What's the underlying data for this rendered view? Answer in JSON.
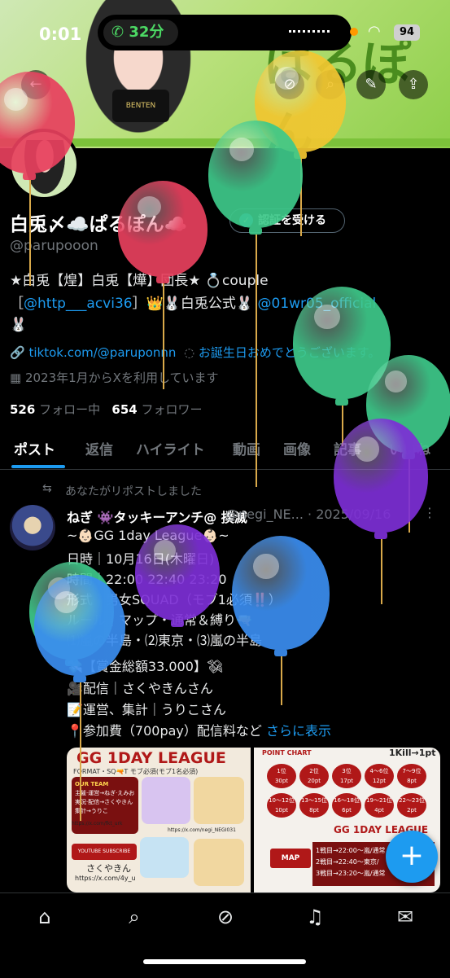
{
  "status_bar": {
    "time": "0:01",
    "call_duration": "32分",
    "battery": "94"
  },
  "banner": {
    "logo_text": "ぱるぽん",
    "shirt_text": "BENTEN"
  },
  "profile": {
    "display_name": "白兎〆☁️ぱるぽん☁️",
    "verify_button": "認証を受ける",
    "handle": "@parupooon",
    "bio_line1": "★白兎【煌】白兎【燁】団長★ 💍couple",
    "bio_line2_prefix": "［",
    "bio_mention1": "@http___acvi36",
    "bio_line2_mid": "］👑🐰白兎公式🐰",
    "bio_mention2": "@01wr05_official",
    "bio_line3": "🐰",
    "website": "tiktok.com/@paruponnn",
    "birthday": "お誕生日おめでとうございます。",
    "joined": "2023年1月からXを利用しています",
    "following_count": "526",
    "following_label": "フォロー中",
    "followers_count": "654",
    "followers_label": "フォロワー"
  },
  "tabs": [
    {
      "label": "ポスト"
    },
    {
      "label": "返信"
    },
    {
      "label": "ハイライト"
    },
    {
      "label": "動画"
    },
    {
      "label": "画像"
    },
    {
      "label": "記事"
    },
    {
      "label": "いいね"
    }
  ],
  "post": {
    "repost_note": "あなたがリポストしました",
    "author_name": "ねぎ 👾タッキーアンチ@ 撲滅",
    "author_handle": "@negi_NE...",
    "date": "2025/09/16",
    "lines": [
      "~👶🏻GG 1day League👶🏻~",
      "日時｜10月16日(木曜日)",
      "時間｜22:00 22:40 23:20",
      "形式｜男女SQUAD（モブ1必須‼️）",
      "ルール｜マップ・通常＆縛り🔫",
      "⑴嵐の半島・⑵東京・⑶嵐の半島",
      "💸【賞金総額33.000】💸︎",
      "🎥配信｜さくやきんさん",
      "📝運営、集計｜うりこさん",
      "📍参加費（700pay）配信料など"
    ],
    "show_more": "さらに表示",
    "media_left_title": "GG 1DAY LEAGUE",
    "media_left_sub": "FORMAT・SQ🔫T モブ必須(モブ1名必須)",
    "media_left_team": "OUR TEAM",
    "media_left_team_lines": [
      "主催·運営→ねぎ·えみお",
      "実況·配信→さくやきん",
      "集計→うりこ"
    ],
    "media_left_url1": "https://x.com/fkt_urk",
    "media_left_url2": "https://x.com/negi_NEGI031",
    "media_left_youtube": "YOUTUBE SUBSCRIBE",
    "media_left_name": "さくやきん",
    "media_left_url3": "https://x.com/4y_u",
    "media_right_header": "POINT CHART",
    "media_right_kill": "1Kill→1pt",
    "media_right_points": [
      [
        "1位",
        "30pt"
      ],
      [
        "2位",
        "20pt"
      ],
      [
        "3位",
        "17pt"
      ],
      [
        "4〜6位",
        "12pt"
      ],
      [
        "7〜9位",
        "8pt"
      ],
      [
        "10〜12位",
        "10pt"
      ],
      [
        "13〜15位",
        "8pt"
      ],
      [
        "16〜18位",
        "6pt"
      ],
      [
        "19〜21位",
        "4pt"
      ],
      [
        "22〜23位",
        "2pt"
      ]
    ],
    "media_right_title": "GG 1DAY LEAGUE",
    "media_right_map": "MAP",
    "media_right_rounds": [
      "1戦目→22:00〜嵐/通常",
      "2戦目→22:40〜東京/",
      "3戦目→23:20〜嵐/通常"
    ]
  },
  "fab_label": "+",
  "nav": {
    "home": "home-icon",
    "search": "search-icon",
    "grok": "grok-icon",
    "notifications": "bell-icon",
    "messages": "mail-icon"
  },
  "colors": {
    "accent": "#1d9bf0",
    "balloon_red": "#e8405e",
    "balloon_yellow": "#f2c630",
    "balloon_green": "#3ec98a",
    "balloon_purple": "#7d2fd6",
    "balloon_blue": "#3b8ef0"
  }
}
